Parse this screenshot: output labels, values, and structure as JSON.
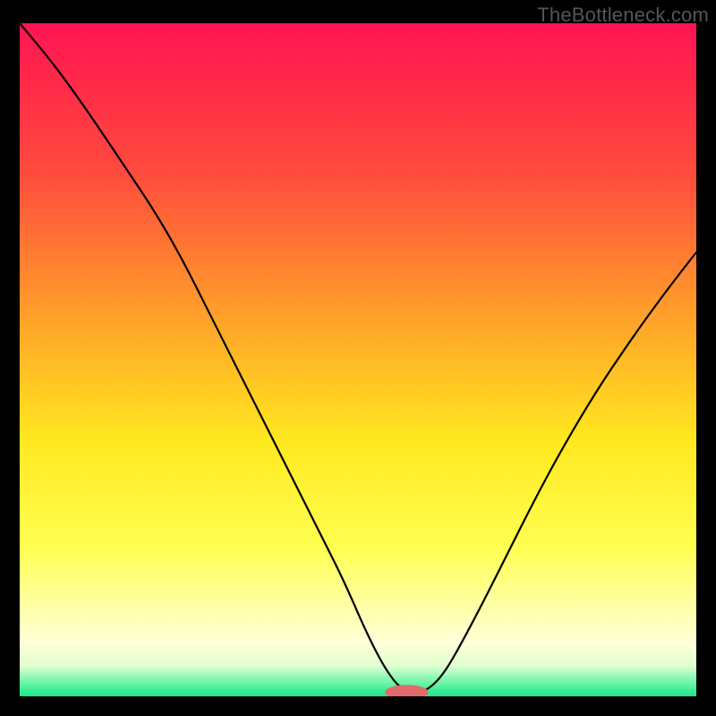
{
  "watermark": "TheBottleneck.com",
  "chart_data": {
    "type": "line",
    "title": "",
    "xlabel": "",
    "ylabel": "",
    "xlim": [
      0,
      100
    ],
    "ylim": [
      0,
      100
    ],
    "background_gradient_stops": [
      {
        "offset": 0.0,
        "color": "#ff1452"
      },
      {
        "offset": 0.22,
        "color": "#ff4a3d"
      },
      {
        "offset": 0.45,
        "color": "#ffa628"
      },
      {
        "offset": 0.62,
        "color": "#ffe81f"
      },
      {
        "offset": 0.78,
        "color": "#ffff52"
      },
      {
        "offset": 0.87,
        "color": "#ffffaa"
      },
      {
        "offset": 0.92,
        "color": "#ffffd8"
      },
      {
        "offset": 0.955,
        "color": "#e0ffd0"
      },
      {
        "offset": 0.975,
        "color": "#80f8b0"
      },
      {
        "offset": 1.0,
        "color": "#1ce68a"
      }
    ],
    "series": [
      {
        "name": "bottleneck-curve",
        "x": [
          0,
          5,
          10,
          15,
          20,
          24,
          28,
          32,
          36,
          40,
          44,
          48,
          51,
          53.5,
          55.5,
          57,
          58.5,
          60,
          62,
          64,
          68,
          72,
          76,
          80,
          85,
          90,
          95,
          100
        ],
        "y": [
          100,
          94,
          87,
          79.5,
          72,
          65,
          57,
          49,
          41,
          33,
          25,
          17,
          10,
          5,
          2,
          0.8,
          0.5,
          0.8,
          2.5,
          5.5,
          13,
          21,
          29,
          36.5,
          45,
          52.5,
          59.5,
          66
        ]
      }
    ],
    "marker": {
      "name": "optimal-point",
      "cx": 57.2,
      "cy": 0.6,
      "rx": 3.2,
      "ry": 1.1,
      "fill": "#e26a6a"
    }
  }
}
